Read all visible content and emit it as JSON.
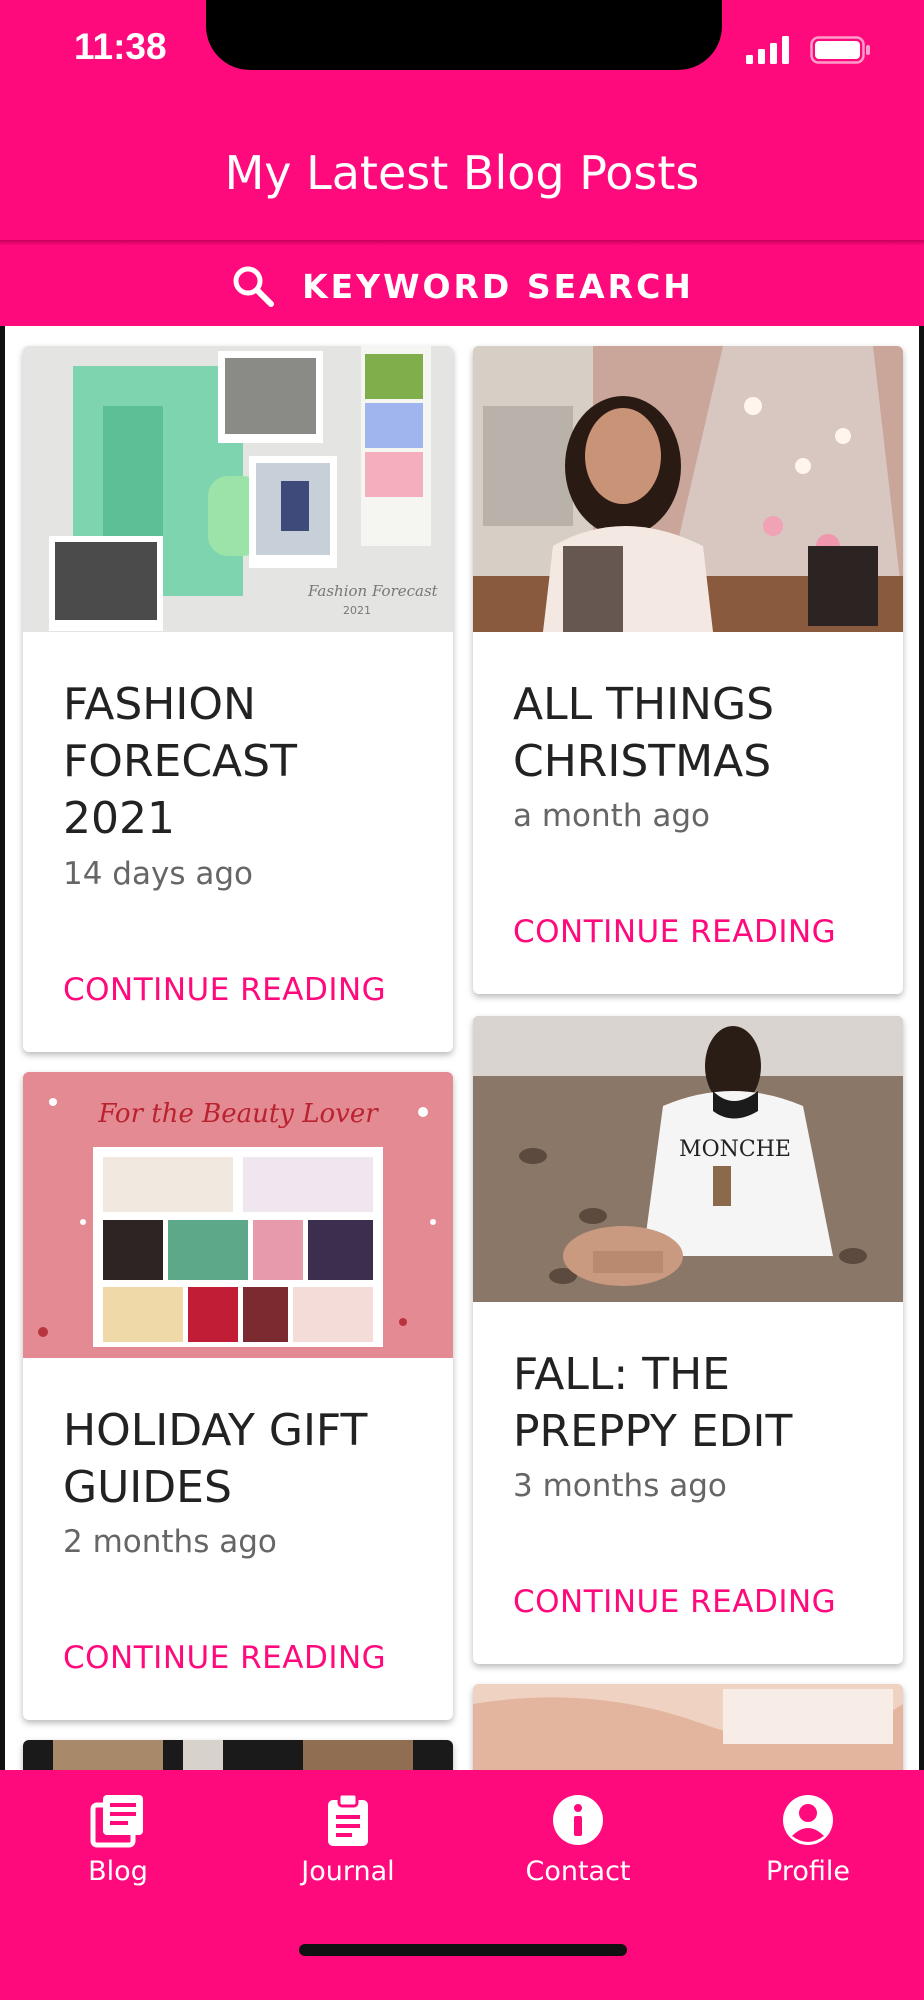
{
  "status_bar": {
    "time": "11:38"
  },
  "header": {
    "title": "My Latest Blog Posts"
  },
  "search": {
    "label": "KEYWORD SEARCH"
  },
  "posts": [
    {
      "title": "FASHION FORECAST 2021",
      "date": "14 days ago",
      "link": "CONTINUE READING"
    },
    {
      "title": "ALL THINGS CHRISTMAS",
      "date": "a month ago",
      "link": "CONTINUE READING"
    },
    {
      "title": "HOLIDAY GIFT GUIDES",
      "date": "2 months ago",
      "link": "CONTINUE READING"
    },
    {
      "title": "FALL: THE PREPPY EDIT",
      "date": "3 months ago",
      "link": "CONTINUE READING"
    }
  ],
  "images": {
    "fashion": {
      "script": "Fashion Forecast",
      "year": "2021"
    },
    "gift": {
      "script": "For the Beauty Lover"
    },
    "sweater": {
      "text": "MONCHE"
    }
  },
  "nav": [
    {
      "label": "Blog",
      "icon": "blog-icon"
    },
    {
      "label": "Journal",
      "icon": "clipboard-icon"
    },
    {
      "label": "Contact",
      "icon": "info-icon"
    },
    {
      "label": "Profile",
      "icon": "account-icon"
    }
  ],
  "colors": {
    "accent": "#ff0a7c",
    "text": "#222222",
    "muted": "#666666"
  }
}
